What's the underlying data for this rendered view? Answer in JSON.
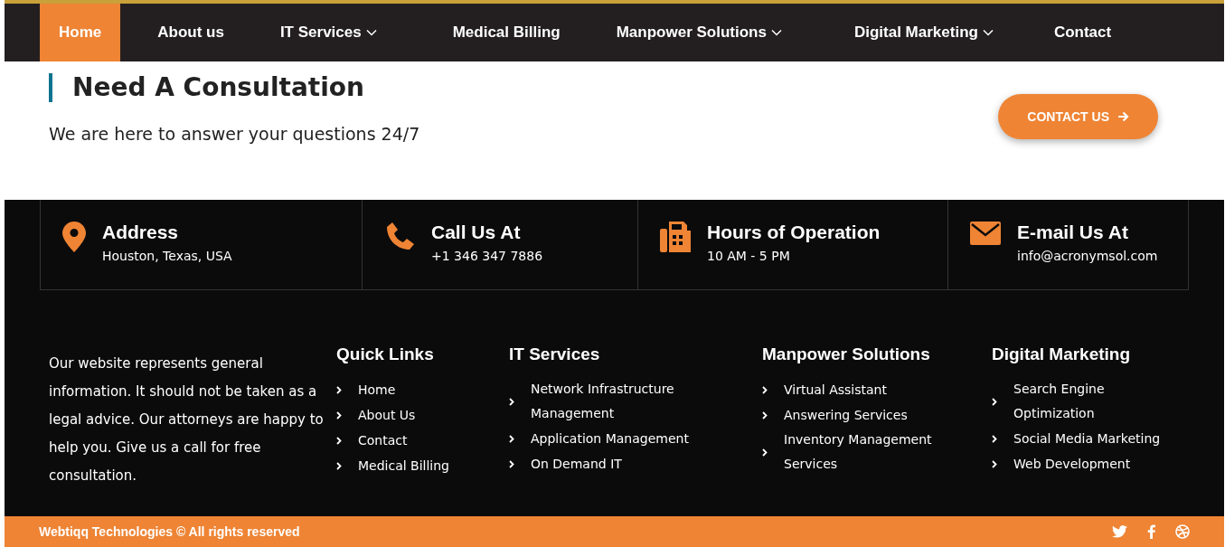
{
  "nav": [
    {
      "label": "Home",
      "selected": true,
      "dropdown": false
    },
    {
      "label": "About us",
      "selected": false,
      "dropdown": false
    },
    {
      "label": "IT Services",
      "selected": false,
      "dropdown": true
    },
    {
      "label": "Medical Billing",
      "selected": false,
      "dropdown": false
    },
    {
      "label": "Manpower Solutions",
      "selected": false,
      "dropdown": true
    },
    {
      "label": "Digital Marketing",
      "selected": false,
      "dropdown": true
    },
    {
      "label": "Contact",
      "selected": false,
      "dropdown": false
    }
  ],
  "consultation": {
    "title": "Need A Consultation",
    "subtitle": "We are here to answer your questions 24/7",
    "button": "CONTACT US"
  },
  "contacts": [
    {
      "kind": "pin",
      "title": "Address",
      "value": "Houston, Texas, USA"
    },
    {
      "kind": "phone",
      "title": "Call Us At",
      "value": "+1 346 347 7886"
    },
    {
      "kind": "fax",
      "title": "Hours of Operation",
      "value": "10 AM - 5 PM"
    },
    {
      "kind": "mail",
      "title": "E-mail Us At",
      "value": "info@acronymsol.com"
    }
  ],
  "about": "Our website represents general information. It should not be taken as a legal advice. Our attorneys are happy to help you. Give us a call for free consultation.",
  "columns": [
    {
      "title": "Quick Links",
      "links": [
        "Home",
        "About Us",
        "Contact",
        "Medical Billing"
      ]
    },
    {
      "title": "IT Services",
      "links": [
        "Network Infrastructure Management",
        "Application Management",
        "On Demand IT"
      ]
    },
    {
      "title": "Manpower Solutions",
      "links": [
        "Virtual Assistant",
        "Answering Services",
        "Inventory Management Services"
      ]
    },
    {
      "title": "Digital Marketing",
      "links": [
        "Search Engine Optimization",
        "Social Media Marketing",
        "Web Development"
      ]
    }
  ],
  "copyright": "Webtiqq Technologies © All rights reserved",
  "social": [
    {
      "kind": "twitter"
    },
    {
      "kind": "facebook"
    },
    {
      "kind": "dribbble"
    }
  ]
}
